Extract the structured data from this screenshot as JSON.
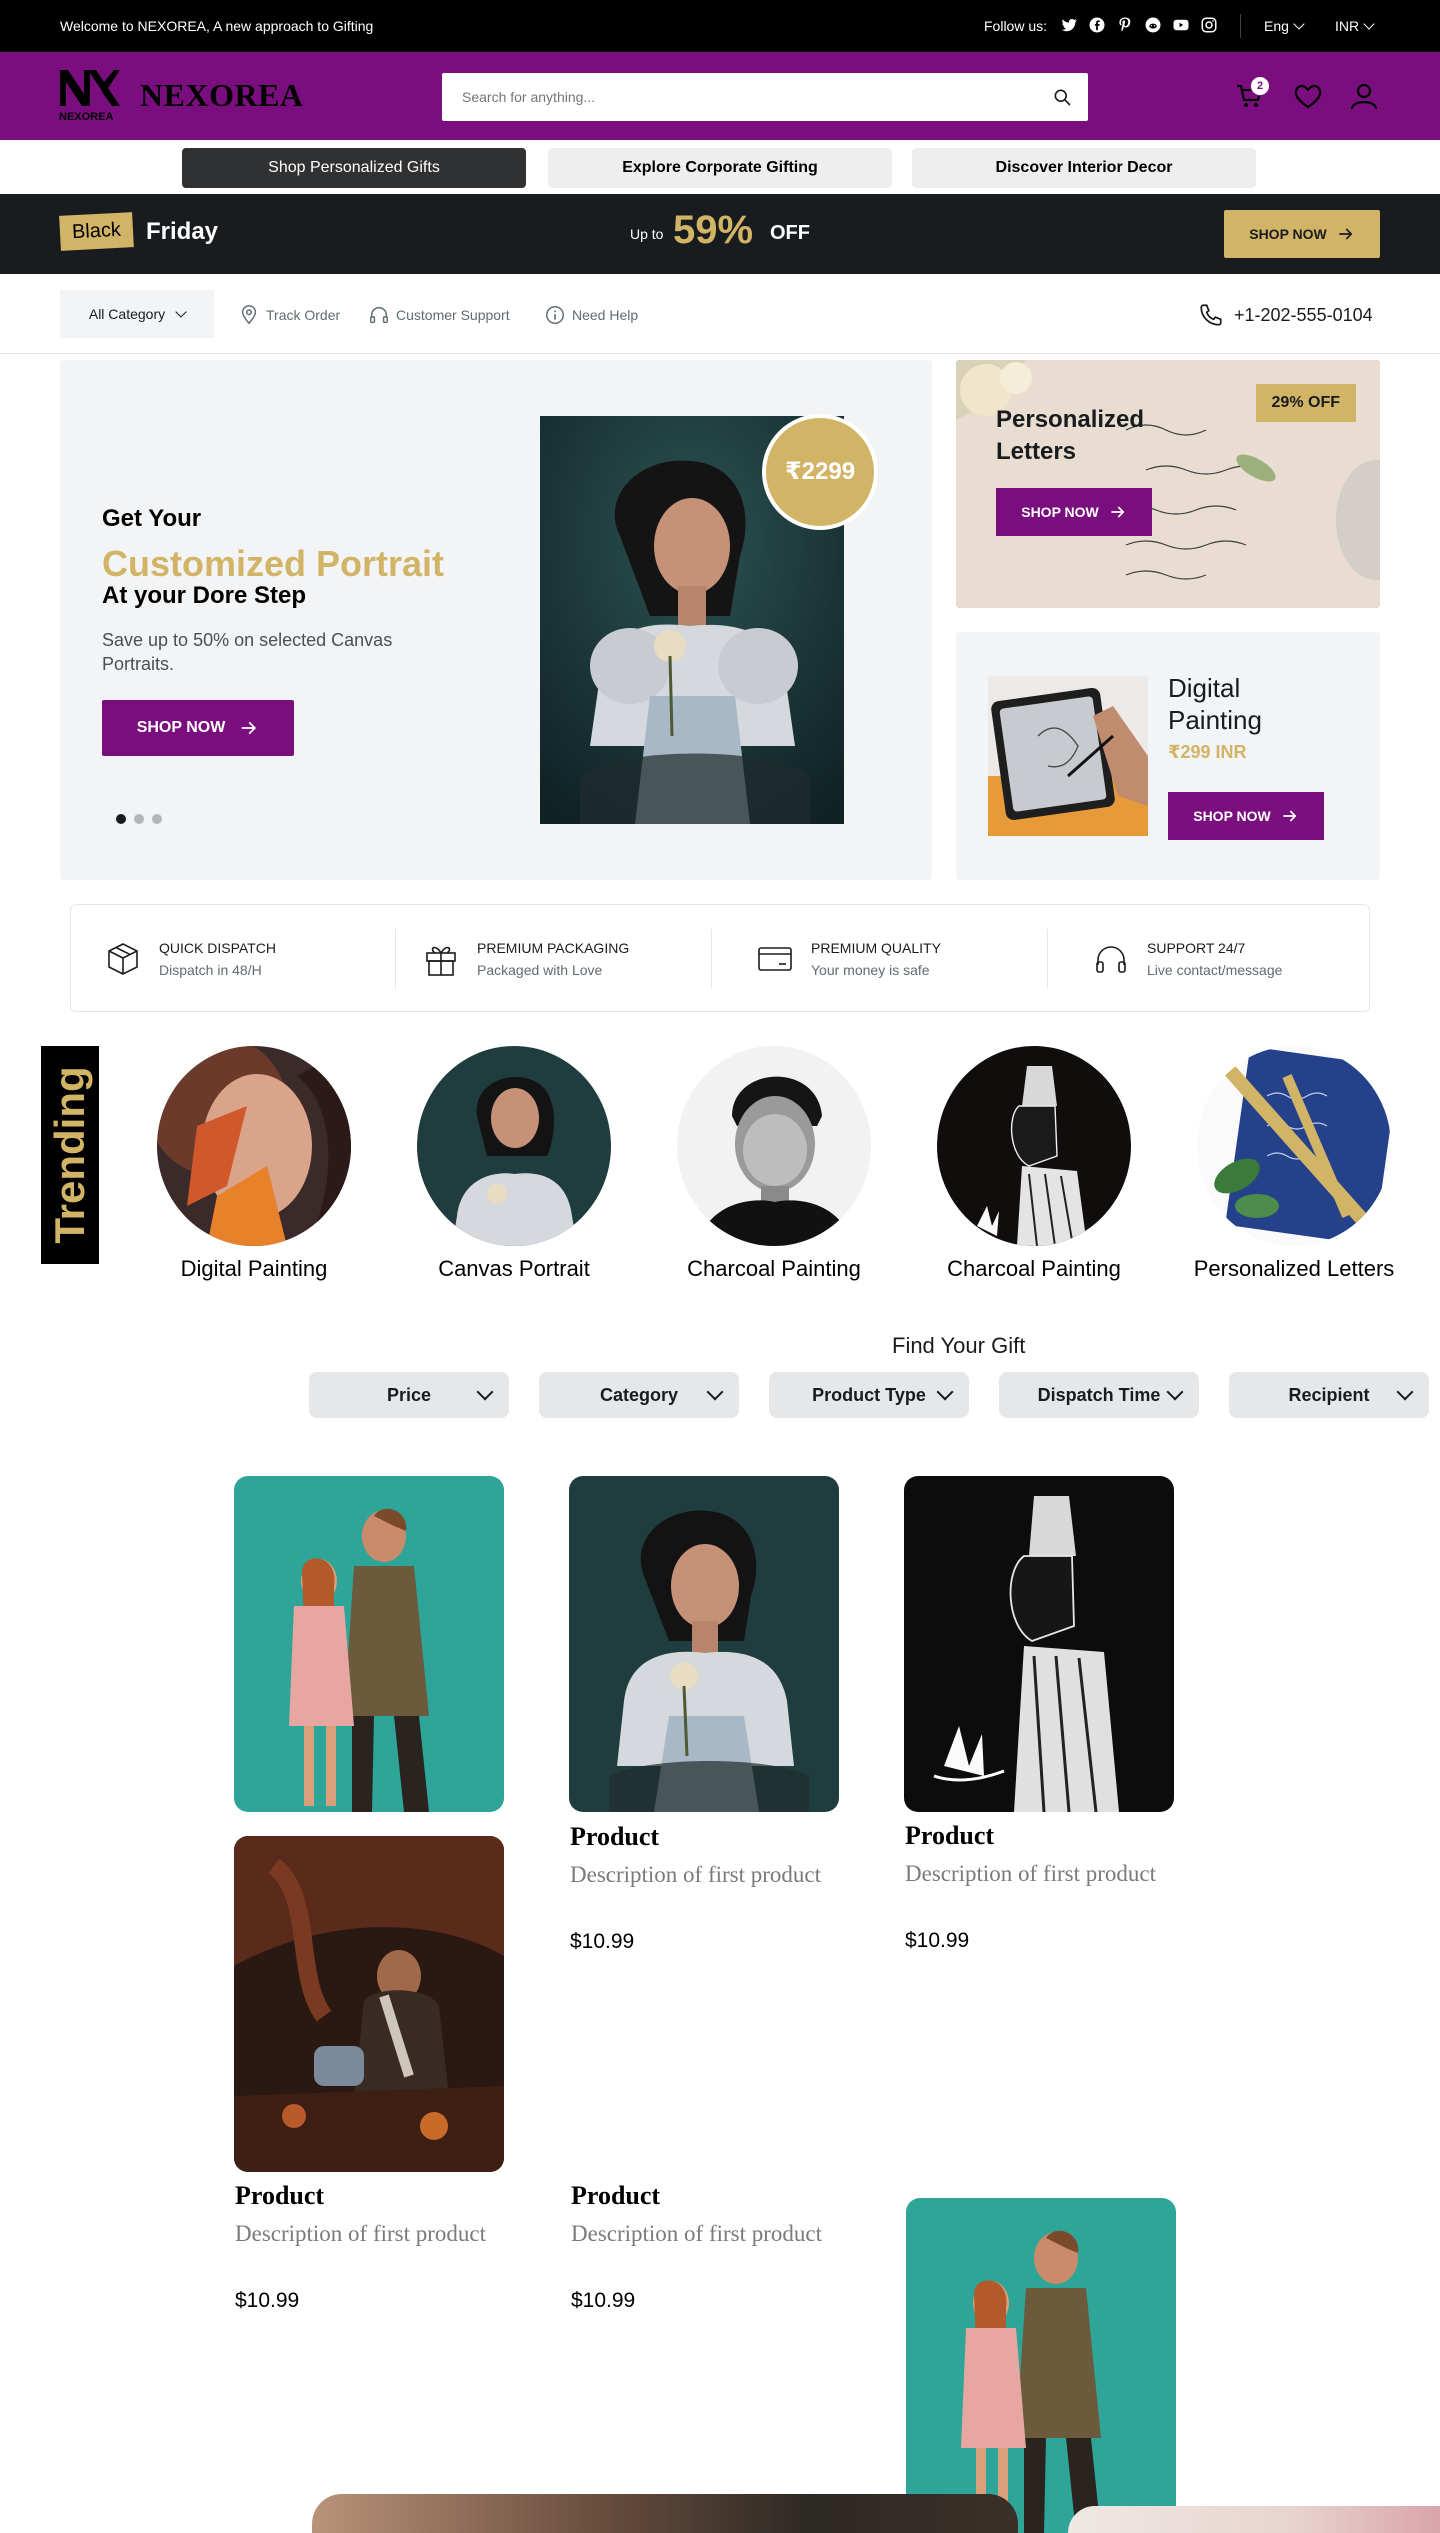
{
  "topbar": {
    "welcome": "Welcome to NEXOREA, A new approach to Gifting",
    "follow_label": "Follow us:",
    "social_icons": [
      "twitter-icon",
      "facebook-icon",
      "pinterest-icon",
      "reddit-icon",
      "youtube-icon",
      "instagram-icon"
    ],
    "language": "Eng",
    "currency": "INR"
  },
  "header": {
    "brand": "NEXOREA",
    "logo_subtext": "NEXOREA",
    "search_placeholder": "Search for anything...",
    "cart_count": "2",
    "colors": {
      "brand_purple": "#7b0e7e",
      "accent_gold": "#d2b467"
    }
  },
  "tabs": [
    {
      "label": "Shop Personalized Gifts",
      "active": true
    },
    {
      "label": "Explore Corporate Gifting",
      "active": false
    },
    {
      "label": "Discover Interior Decor",
      "active": false
    }
  ],
  "promo": {
    "black": "Black",
    "friday": "Friday",
    "up_to": "Up to",
    "percent": "59%",
    "off": "OFF",
    "cta": "SHOP NOW"
  },
  "nav": {
    "all_category": "All Category",
    "track_order": "Track Order",
    "customer_support": "Customer Support",
    "need_help": "Need Help",
    "phone": "+1-202-555-0104"
  },
  "hero": {
    "line1": "Get Your",
    "line2": "Customized Portrait",
    "line3": "At your Dore Step",
    "subtitle": "Save up to 50% on selected Canvas Portraits.",
    "cta": "SHOP NOW",
    "price_badge": "₹2299",
    "slides": 3,
    "active_slide": 1
  },
  "side_cards": {
    "letters": {
      "title": "Personalized Letters",
      "discount": "29% OFF",
      "cta": "SHOP NOW"
    },
    "digital": {
      "title": "Digital Painting",
      "price": "₹299 INR",
      "cta": "SHOP NOW"
    }
  },
  "features": [
    {
      "icon": "package-icon",
      "title": "QUICK DISPATCH",
      "subtitle": "Dispatch in 48/H"
    },
    {
      "icon": "gift-icon",
      "title": "PREMIUM PACKAGING",
      "subtitle": "Packaged with Love"
    },
    {
      "icon": "credit-card-icon",
      "title": "PREMIUM QUALITY",
      "subtitle": "Your money is safe"
    },
    {
      "icon": "headphones-icon",
      "title": "SUPPORT 24/7",
      "subtitle": "Live contact/message"
    }
  ],
  "trending": {
    "tag": "Trending",
    "items": [
      "Digital Painting",
      "Canvas Portrait",
      "Charcoal Painting",
      "Charcoal Painting",
      "Personalized Letters"
    ]
  },
  "find_gift": {
    "title": "Find Your Gift",
    "filters": [
      "Price",
      "Category",
      "Product Type",
      "Dispatch Time",
      "Recipient"
    ]
  },
  "products": [
    {
      "name": "Product",
      "description": "Description of first product",
      "price": "$10.99"
    },
    {
      "name": "Product",
      "description": "Description of first product",
      "price": "$10.99"
    },
    {
      "name": "Product",
      "description": "Description of first product",
      "price": "$10.99"
    },
    {
      "name": "Product",
      "description": "Description of first product",
      "price": "$10.99"
    }
  ]
}
